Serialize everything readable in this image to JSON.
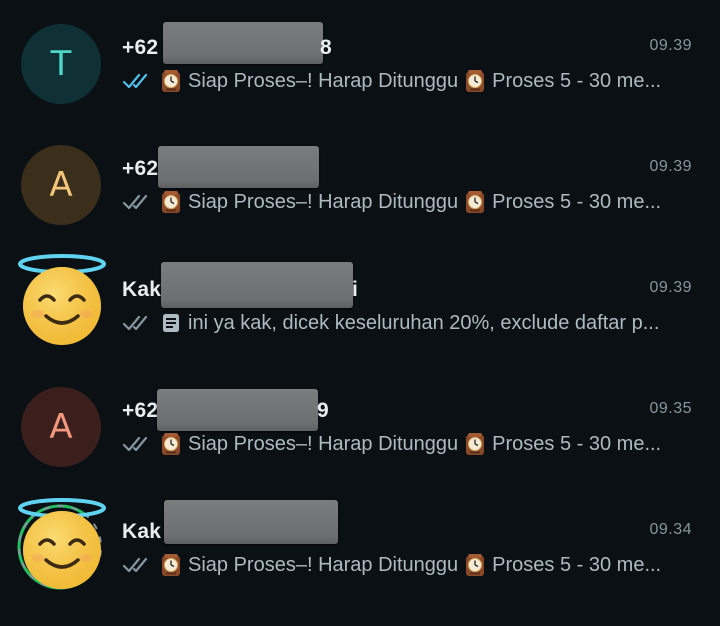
{
  "colors": {
    "background": "#0b1014",
    "primary_text": "#e9edef",
    "secondary_text": "#aebac1",
    "read_tick": "#53bdeb",
    "delivered_tick": "#8696a0"
  },
  "chats": [
    {
      "avatar_letter": "T",
      "name_prefix": "+62",
      "name_suffix": "8",
      "time": "09.39",
      "tick_state": "read",
      "preview_part1": "Siap Proses–! Harap Ditunggu",
      "preview_part2": "Proses 5 - 30 me..."
    },
    {
      "avatar_letter": "A",
      "name_prefix": "+62",
      "name_suffix": "",
      "time": "09.39",
      "tick_state": "delivered",
      "preview_part1": "Siap Proses–! Harap Ditunggu",
      "preview_part2": "Proses 5 - 30 me..."
    },
    {
      "avatar_icon": "angel-emoji-icon",
      "name_prefix": "Kak",
      "name_suffix": "i",
      "time": "09.39",
      "tick_state": "delivered",
      "preview_text": "ini ya kak, dicek keseluruhan 20%, exclude daftar p..."
    },
    {
      "avatar_letter": "A",
      "name_prefix": "+62",
      "name_suffix": "9",
      "time": "09.35",
      "tick_state": "delivered",
      "preview_part1": "Siap Proses–! Harap Ditunggu",
      "preview_part2": "Proses 5 - 30 me..."
    },
    {
      "avatar_icon": "angel-emoji-icon",
      "name_prefix": "Kak",
      "name_suffix": "",
      "time": "09.34",
      "tick_state": "delivered",
      "preview_part1": "Siap Proses–! Harap Ditunggu",
      "preview_part2": "Proses 5 - 30 me..."
    }
  ]
}
